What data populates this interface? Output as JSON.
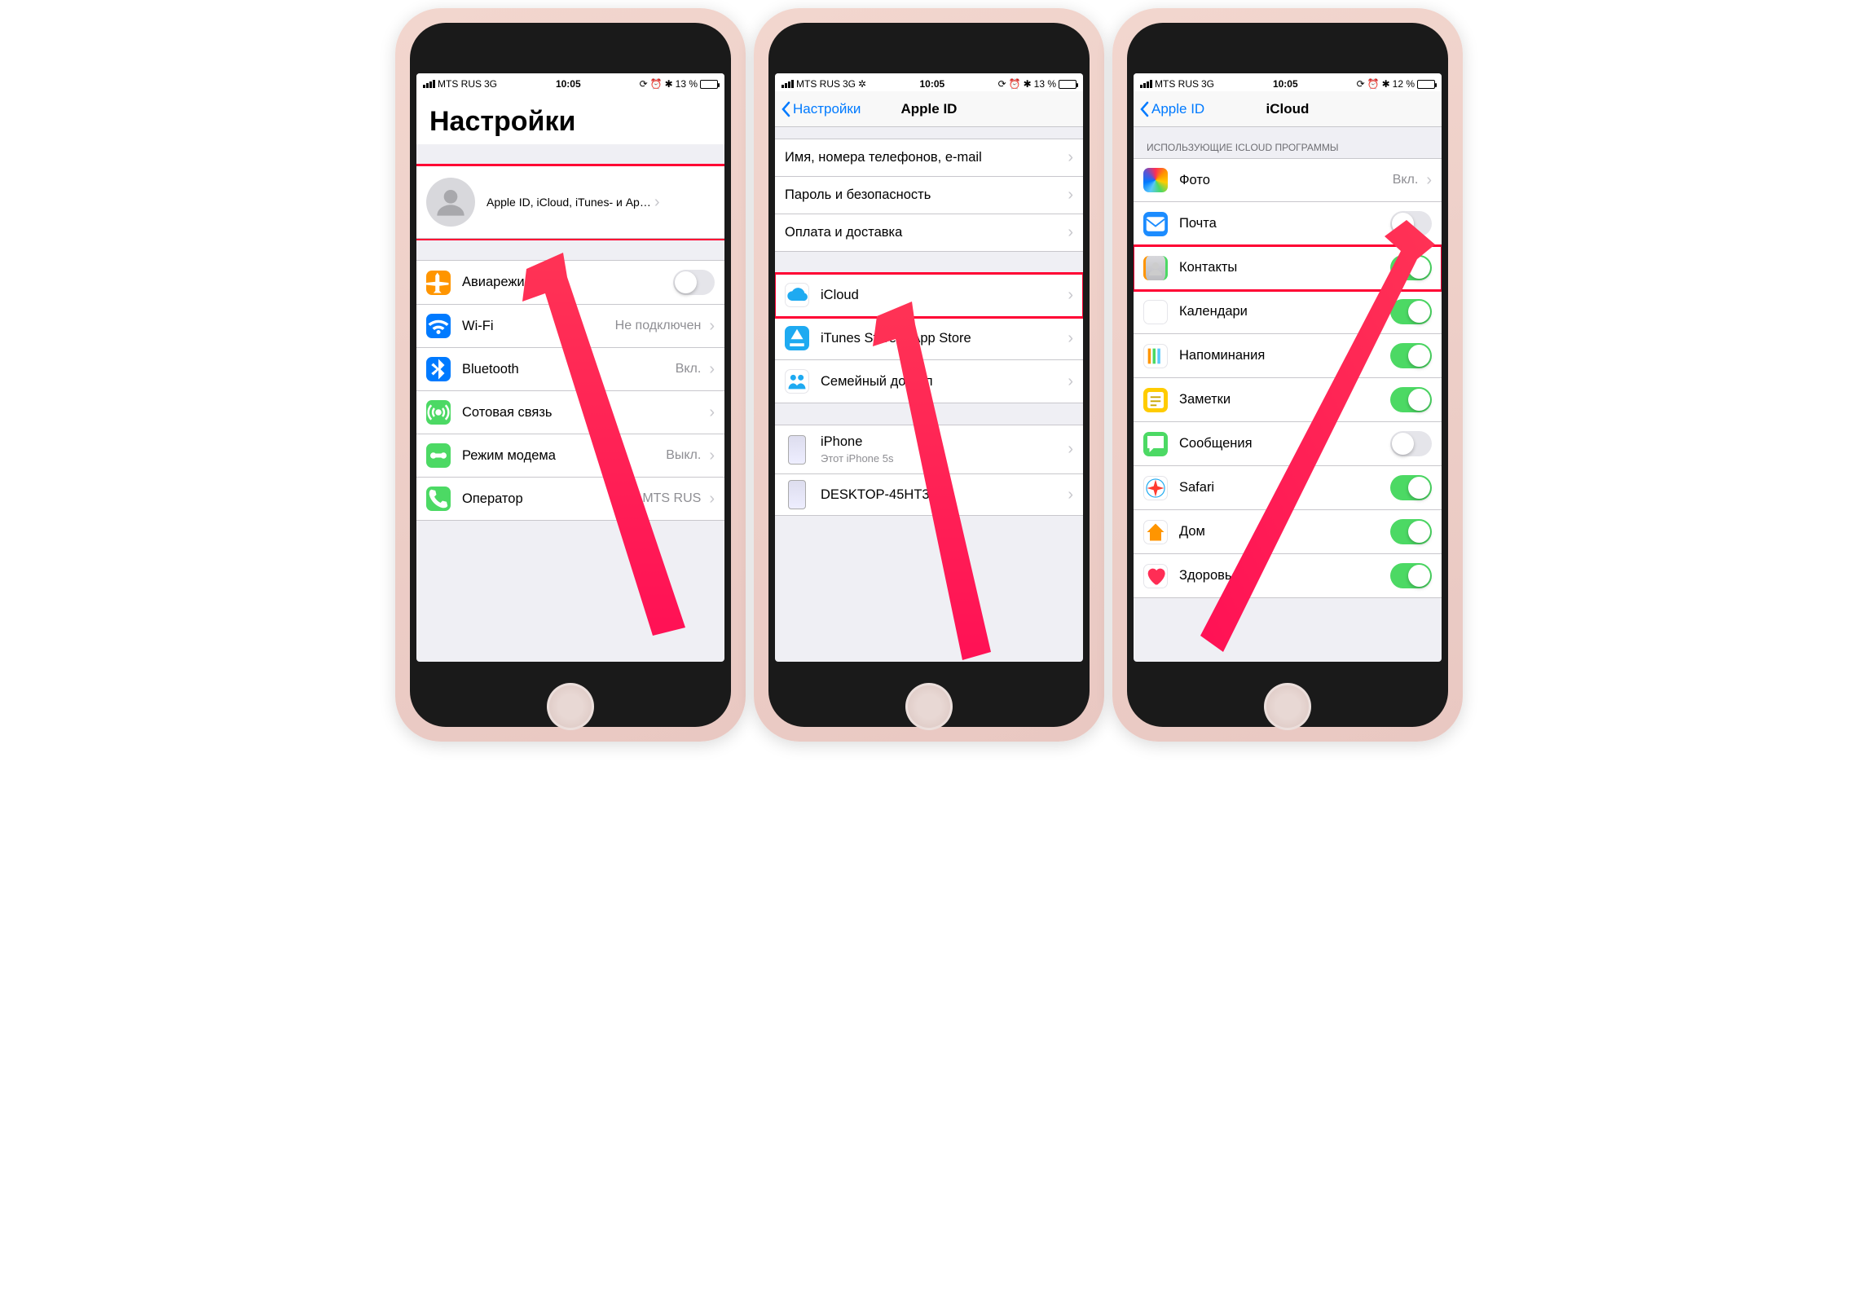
{
  "status": {
    "carrier": "MTS RUS",
    "net": "3G",
    "time": "10:05",
    "battery1": "13 %",
    "battery2": "13 %",
    "battery3": "12 %"
  },
  "p1": {
    "title": "Настройки",
    "profile_sub": "Apple ID, iCloud, iTunes- и Ap…",
    "rows": [
      {
        "label": "Авиарежим",
        "toggle": false,
        "icon": "airplane",
        "bg": "#ff9500"
      },
      {
        "label": "Wi-Fi",
        "value": "Не подключен",
        "icon": "wifi",
        "bg": "#007aff"
      },
      {
        "label": "Bluetooth",
        "value": "Вкл.",
        "icon": "bt",
        "bg": "#007aff"
      },
      {
        "label": "Сотовая связь",
        "icon": "cell",
        "bg": "#4cd964"
      },
      {
        "label": "Режим модема",
        "value": "Выкл.",
        "icon": "hotspot",
        "bg": "#4cd964"
      },
      {
        "label": "Оператор",
        "value": "MTS RUS",
        "icon": "phone",
        "bg": "#4cd964"
      }
    ]
  },
  "p2": {
    "back": "Настройки",
    "title": "Apple ID",
    "group1": [
      "Имя, номера телефонов, e-mail",
      "Пароль и безопасность",
      "Оплата и доставка"
    ],
    "group2": [
      {
        "label": "iCloud",
        "icon": "icloud",
        "bg": "#fff",
        "hl": true
      },
      {
        "label": "iTunes Store и App Store",
        "icon": "appstore",
        "bg": "#1eaaf1"
      },
      {
        "label": "Семейный доступ",
        "icon": "family",
        "bg": "#fff"
      }
    ],
    "devices": [
      {
        "label": "iPhone",
        "sub": "Этот iPhone 5s"
      },
      {
        "label": "DESKTOP-45HT3NV"
      }
    ]
  },
  "p3": {
    "back": "Apple ID",
    "title": "iCloud",
    "header": "ИСПОЛЬЗУЮЩИЕ ICLOUD ПРОГРАММЫ",
    "rows": [
      {
        "label": "Фото",
        "value": "Вкл.",
        "icon": "photos",
        "type": "link"
      },
      {
        "label": "Почта",
        "toggle": false,
        "icon": "mail",
        "bg": "#1c8cff"
      },
      {
        "label": "Контакты",
        "toggle": true,
        "icon": "contacts",
        "bg": "#8e8e93",
        "hl": true
      },
      {
        "label": "Календари",
        "toggle": true,
        "icon": "calendar",
        "bg": "#fff"
      },
      {
        "label": "Напоминания",
        "toggle": true,
        "icon": "reminders",
        "bg": "#fff"
      },
      {
        "label": "Заметки",
        "toggle": true,
        "icon": "notes",
        "bg": "#ffcc00"
      },
      {
        "label": "Сообщения",
        "toggle": false,
        "icon": "messages",
        "bg": "#4cd964"
      },
      {
        "label": "Safari",
        "toggle": true,
        "icon": "safari",
        "bg": "#fff"
      },
      {
        "label": "Дом",
        "toggle": true,
        "icon": "home",
        "bg": "#fff"
      },
      {
        "label": "Здоровье",
        "toggle": true,
        "icon": "health",
        "bg": "#fff"
      }
    ]
  }
}
